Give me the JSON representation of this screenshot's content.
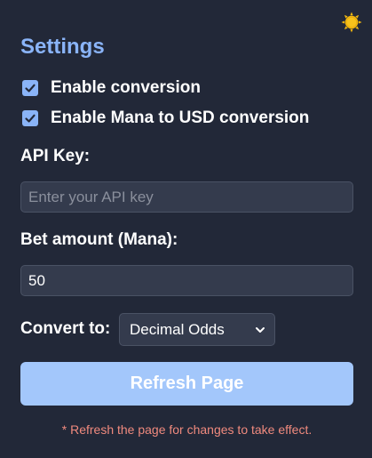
{
  "colors": {
    "background": "#222838",
    "accent": "#8ab4f8",
    "button": "#a3c7fb",
    "input_bg": "#343b4d",
    "note": "#f08a7e",
    "sun": "#f5b90f"
  },
  "header": {
    "theme_icon": "sun-icon"
  },
  "settings": {
    "title": "Settings",
    "checkboxes": [
      {
        "label": "Enable conversion",
        "checked": true
      },
      {
        "label": "Enable Mana to USD conversion",
        "checked": true
      }
    ],
    "api_key": {
      "label": "API Key:",
      "value": "",
      "placeholder": "Enter your API key"
    },
    "bet_amount": {
      "label": "Bet amount (Mana):",
      "value": "50"
    },
    "convert_to": {
      "label": "Convert to:",
      "selected": "Decimal Odds"
    },
    "refresh_label": "Refresh Page",
    "note": "* Refresh the page for changes to take effect."
  }
}
